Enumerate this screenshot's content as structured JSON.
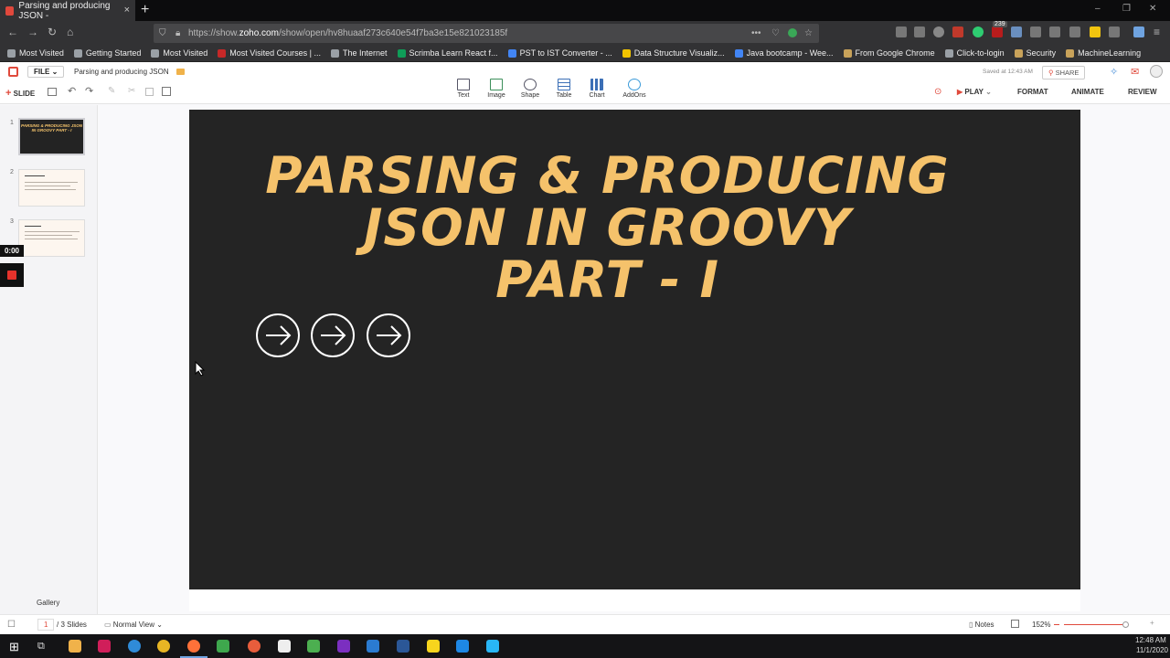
{
  "browser": {
    "tab_title": "Parsing and producing JSON -",
    "tab_close": "×",
    "new_tab": "+",
    "url_prefix": "https://show.",
    "url_host": "zoho.com",
    "url_rest": "/show/open/hv8huaaf273c640e54f7ba3e15e821023185f",
    "ext_badge": "239",
    "window_controls": [
      "–",
      "❐",
      "✕"
    ]
  },
  "bookmarks": [
    {
      "label": "Most Visited",
      "color": "#9aa0a6"
    },
    {
      "label": "Getting Started",
      "color": "#9aa0a6"
    },
    {
      "label": "Most Visited",
      "color": "#9aa0a6"
    },
    {
      "label": "Most Visited Courses | ...",
      "color": "#c62828"
    },
    {
      "label": "The Internet",
      "color": "#9aa0a6"
    },
    {
      "label": "Scrimba Learn React f...",
      "color": "#0f9d58"
    },
    {
      "label": "PST to IST Converter - ...",
      "color": "#4285f4"
    },
    {
      "label": "Data Structure Visualiz...",
      "color": "#f2c400"
    },
    {
      "label": "Java bootcamp - Wee...",
      "color": "#4285f4"
    },
    {
      "label": "From Google Chrome",
      "color": "#c8a25a"
    },
    {
      "label": "Click-to-login",
      "color": "#9aa0a6"
    },
    {
      "label": "Security",
      "color": "#c8a25a"
    },
    {
      "label": "MachineLearning",
      "color": "#c8a25a"
    }
  ],
  "app": {
    "file_menu": "FILE",
    "doc_title": "Parsing and producing JSON",
    "saved_status": "Saved at 12:43 AM",
    "share": "SHARE",
    "add_slide": "SLIDE",
    "insert_tools": [
      "Text",
      "Image",
      "Shape",
      "Table",
      "Chart",
      "AddOns"
    ],
    "play": "PLAY",
    "right_tabs": [
      "FORMAT",
      "ANIMATE",
      "REVIEW"
    ]
  },
  "sidebar": {
    "slides": [
      {
        "num": "1",
        "thumb_title": "PARSING & PRODUCING JSON IN GROOVY PART - I"
      },
      {
        "num": "2",
        "thumb_title": ""
      },
      {
        "num": "3",
        "thumb_title": ""
      }
    ],
    "timer": "0:00",
    "gallery": "Gallery"
  },
  "slide": {
    "title_lines": [
      "PARSING & PRODUCING",
      "JSON IN GROOVY",
      "PART - I"
    ],
    "title_color": "#f5c26b",
    "background": "#242424",
    "arrow_icons": 3
  },
  "statusbar": {
    "current_page": "1",
    "total_slides": "/ 3 Slides",
    "view_mode": "Normal View",
    "notes": "Notes",
    "zoom": "152%"
  },
  "taskbar": {
    "time": "12:48 AM",
    "date": "11/1/2020"
  }
}
